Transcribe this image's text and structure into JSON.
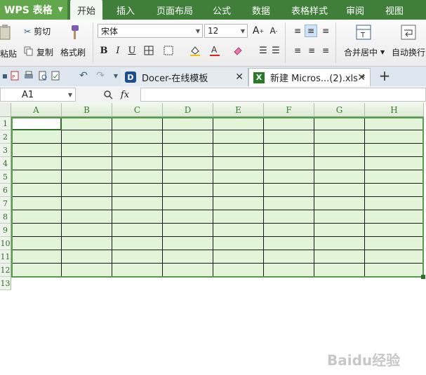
{
  "app": {
    "title": "WPS 表格"
  },
  "menu": {
    "items": [
      "开始",
      "插入",
      "页面布局",
      "公式",
      "数据",
      "表格样式",
      "审阅",
      "视图"
    ],
    "active": "开始"
  },
  "ribbon": {
    "paste": "粘贴",
    "cut": "剪切",
    "copy": "复制",
    "format_painter": "格式刷",
    "font_name": "宋体",
    "font_size": "12",
    "merge_center": "合并居中",
    "wrap_text": "自动换行"
  },
  "tabs": [
    {
      "label": "Docer-在线模板",
      "icon": "docer-icon",
      "active": false
    },
    {
      "label": "新建 Micros...(2).xls *",
      "icon": "excel-icon",
      "active": true
    }
  ],
  "formula_bar": {
    "name_box": "A1",
    "fx": "fx",
    "value": ""
  },
  "sheet": {
    "columns": [
      "A",
      "B",
      "C",
      "D",
      "E",
      "F",
      "G",
      "H"
    ],
    "rows": [
      "1",
      "2",
      "3",
      "4",
      "5",
      "6",
      "7",
      "8",
      "9",
      "10",
      "11",
      "12",
      "13"
    ],
    "active_cell": "A1",
    "fill_color": "#e3f5d8"
  },
  "watermark": "Baidu经验",
  "colors": {
    "menu_bg": "#3f7f3a",
    "app_button": "#62a74b",
    "grid_header_text": "#3a7a32"
  }
}
